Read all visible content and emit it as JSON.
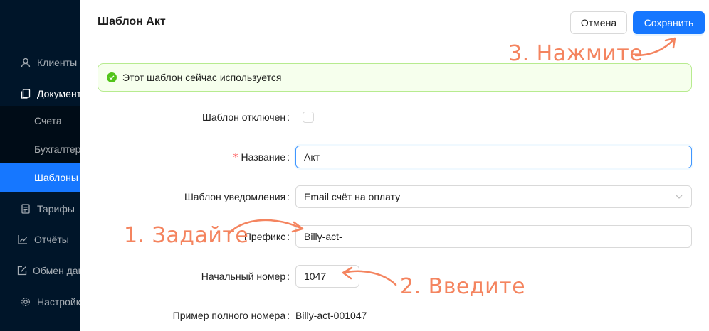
{
  "sidebar": {
    "items": [
      {
        "label": "Клиенты",
        "icon": "user-icon"
      },
      {
        "label": "Документы",
        "icon": "file-copy-icon"
      },
      {
        "label": "Тарифы",
        "icon": "file-text-icon"
      },
      {
        "label": "Отчёты",
        "icon": "line-chart-icon"
      },
      {
        "label": "Обмен данными",
        "icon": "edit-square-icon"
      },
      {
        "label": "Настройки",
        "icon": "gear-icon"
      }
    ],
    "subitems": [
      {
        "label": "Счета"
      },
      {
        "label": "Бухгалтерия"
      },
      {
        "label": "Шаблоны"
      }
    ]
  },
  "drawer": {
    "title": "Шаблон Акт",
    "cancel_label": "Отмена",
    "save_label": "Сохранить"
  },
  "alert": {
    "text": "Этот шаблон сейчас используется",
    "status_color": "#52c41a"
  },
  "form": {
    "disabled_label": "Шаблон отключен",
    "disabled_checked": false,
    "name_label": "Название",
    "name_required_mark": "*",
    "name_value": "Акт",
    "notification_label": "Шаблон уведомления",
    "notification_value": "Email счёт на оплату",
    "prefix_label": "Префикс",
    "prefix_value": "Billy-act-",
    "start_label": "Начальный номер",
    "start_value": "1047",
    "example_label": "Пример полного номера",
    "example_value": "Billy-act-001047"
  },
  "annotations": {
    "step1": "1. Задайте",
    "step2": "2. Введите",
    "step3": "3. Нажмите",
    "color": "#f4845f"
  },
  "colors": {
    "primary": "#1677ff",
    "sidebar_bg": "#001529",
    "success_bg": "#f6ffed",
    "success_border": "#b7eb8f"
  }
}
